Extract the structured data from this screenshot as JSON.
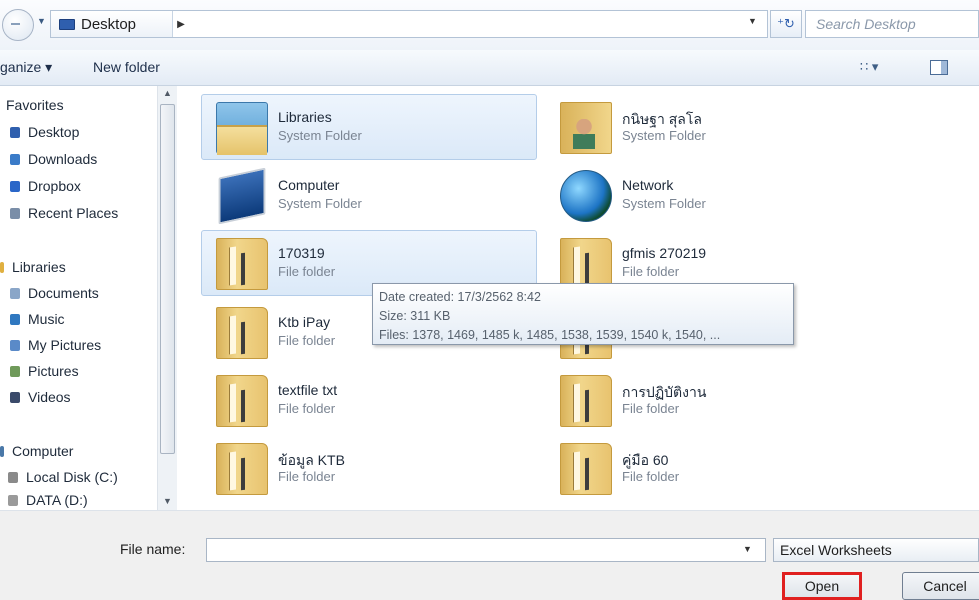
{
  "address": {
    "crumb": "Desktop",
    "search_placeholder": "Search Desktop",
    "icons": [
      "back-icon",
      "desktop-icon",
      "refresh-icon"
    ]
  },
  "toolbar": {
    "organize": "ganize ▾",
    "new_folder": "New folder",
    "views": "∷ ▾"
  },
  "nav": {
    "items": [
      {
        "label": "Favorites",
        "color": "#f0b030"
      },
      {
        "label": "Desktop",
        "color": "#2f5fae"
      },
      {
        "label": "Downloads",
        "color": "#3a7bc8"
      },
      {
        "label": "Dropbox",
        "color": "#2a66c8"
      },
      {
        "label": "Recent Places",
        "color": "#7a8ea8"
      },
      {
        "label": "Libraries",
        "color": "#e0b040"
      },
      {
        "label": "Documents",
        "color": "#8aa6c8"
      },
      {
        "label": "Music",
        "color": "#2f78c0"
      },
      {
        "label": "My Pictures",
        "color": "#5a8ac8"
      },
      {
        "label": "Pictures",
        "color": "#6f9a5a"
      },
      {
        "label": "Videos",
        "color": "#3a4a6a"
      },
      {
        "label": "Computer",
        "color": "#4a78a8"
      },
      {
        "label": "Local Disk (C:)",
        "color": "#8a8a8a"
      },
      {
        "label": "DATA (D:)",
        "color": "#9a9a9a"
      }
    ]
  },
  "files": [
    {
      "name": "Libraries",
      "type": "System Folder"
    },
    {
      "name": "กนิษฐา สุลโล",
      "type": "System Folder"
    },
    {
      "name": "Computer",
      "type": "System Folder"
    },
    {
      "name": "Network",
      "type": "System Folder"
    },
    {
      "name": "170319",
      "type": "File folder"
    },
    {
      "name": "gfmis 270219",
      "type": "File folder"
    },
    {
      "name": "Ktb iPay",
      "type": "File folder"
    },
    {
      "name": "textfile txt",
      "type": "File folder"
    },
    {
      "name": "การปฏิบัติงาน",
      "type": "File folder"
    },
    {
      "name": "ข้อมูล KTB",
      "type": "File folder"
    },
    {
      "name": "คู่มือ 60",
      "type": "File folder"
    }
  ],
  "tooltip": {
    "date_created": "Date created: 17/3/2562 8:42",
    "size": "Size: 311 KB",
    "files": "Files: 1378, 1469, 1485 k, 1485, 1538, 1539, 1540 k, 1540, ..."
  },
  "bottom": {
    "file_name_label": "File name:",
    "file_name_value": "",
    "file_type": "Excel Worksheets",
    "open": "Open",
    "cancel": "Cancel"
  }
}
